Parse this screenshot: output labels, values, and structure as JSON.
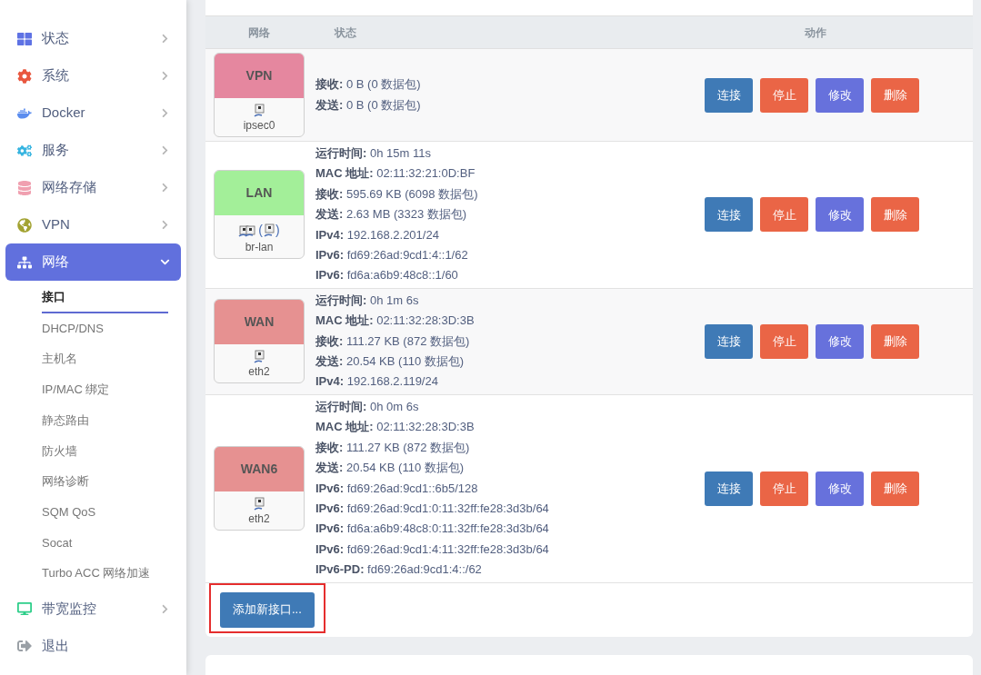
{
  "sidebar": {
    "items": [
      {
        "label": "状态",
        "kind": "dashboard",
        "submenu": true,
        "selected": false,
        "expanded": false
      },
      {
        "label": "系统",
        "kind": "gear",
        "submenu": true,
        "selected": false,
        "expanded": false
      },
      {
        "label": "Docker",
        "kind": "docker",
        "submenu": true,
        "selected": false,
        "expanded": false
      },
      {
        "label": "服务",
        "kind": "cogs",
        "submenu": true,
        "selected": false,
        "expanded": false
      },
      {
        "label": "网络存储",
        "kind": "database",
        "submenu": true,
        "selected": false,
        "expanded": false
      },
      {
        "label": "VPN",
        "kind": "globe",
        "submenu": true,
        "selected": false,
        "expanded": false
      },
      {
        "label": "网络",
        "kind": "sitemap",
        "submenu": true,
        "selected": true,
        "expanded": true,
        "children": [
          {
            "label": "接口",
            "selected": true
          },
          {
            "label": "DHCP/DNS",
            "selected": false
          },
          {
            "label": "主机名",
            "selected": false
          },
          {
            "label": "IP/MAC 绑定",
            "selected": false
          },
          {
            "label": "静态路由",
            "selected": false
          },
          {
            "label": "防火墙",
            "selected": false
          },
          {
            "label": "网络诊断",
            "selected": false
          },
          {
            "label": "SQM QoS",
            "selected": false
          },
          {
            "label": "Socat",
            "selected": false
          },
          {
            "label": "Turbo ACC 网络加速",
            "selected": false
          }
        ]
      },
      {
        "label": "带宽监控",
        "kind": "monitor",
        "submenu": true,
        "selected": false,
        "expanded": false
      },
      {
        "label": "退出",
        "kind": "logout",
        "submenu": false,
        "selected": false,
        "expanded": false
      }
    ]
  },
  "table": {
    "columns": [
      "网络",
      "状态",
      "动作"
    ],
    "rows": [
      {
        "name": "VPN",
        "color": "#e5879f",
        "devices": [
          {
            "kind": "port"
          }
        ],
        "device": "ipsec0",
        "status": [
          "**接收:** 0 B (0 数据包)",
          "**发送:** 0 B (0 数据包)"
        ],
        "actions": [
          "连接",
          "停止",
          "修改",
          "删除"
        ]
      },
      {
        "name": "LAN",
        "color": "#a3ef99",
        "devices": [
          {
            "kind": "ports"
          },
          {
            "kind": "port",
            "open": "(",
            "close": ")"
          }
        ],
        "device": "br-lan",
        "status": [
          "**运行时间:** 0h 15m 11s",
          "**MAC 地址:** 02:11:32:21:0D:BF",
          "**接收:** 595.69 KB (6098 数据包)",
          "**发送:** 2.63 MB (3323 数据包)",
          "**IPv4:** 192.168.2.201/24",
          "**IPv6:** fd69:26ad:9cd1:4::1/62",
          "**IPv6:** fd6a:a6b9:48c8::1/60"
        ],
        "actions": [
          "连接",
          "停止",
          "修改",
          "删除"
        ]
      },
      {
        "name": "WAN",
        "color": "#e69191",
        "devices": [
          {
            "kind": "port"
          }
        ],
        "device": "eth2",
        "status": [
          "**运行时间:** 0h 1m 6s",
          "**MAC 地址:** 02:11:32:28:3D:3B",
          "**接收:** 111.27 KB (872 数据包)",
          "**发送:** 20.54 KB (110 数据包)",
          "**IPv4:** 192.168.2.119/24"
        ],
        "actions": [
          "连接",
          "停止",
          "修改",
          "删除"
        ]
      },
      {
        "name": "WAN6",
        "color": "#e69191",
        "devices": [
          {
            "kind": "port"
          }
        ],
        "device": "eth2",
        "status": [
          "**运行时间:** 0h 0m 6s",
          "**MAC 地址:** 02:11:32:28:3D:3B",
          "**接收:** 111.27 KB (872 数据包)",
          "**发送:** 20.54 KB (110 数据包)",
          "**IPv6:** fd69:26ad:9cd1::6b5/128",
          "**IPv6:** fd69:26ad:9cd1:0:11:32ff:fe28:3d3b/64",
          "**IPv6:** fd6a:a6b9:48c8:0:11:32ff:fe28:3d3b/64",
          "**IPv6:** fd69:26ad:9cd1:4:11:32ff:fe28:3d3b/64",
          "**IPv6-PD:** fd69:26ad:9cd1:4::/62"
        ],
        "actions": [
          "连接",
          "停止",
          "修改",
          "删除"
        ]
      }
    ]
  },
  "add_button": {
    "label": "添加新接口...",
    "highlighted": true
  }
}
